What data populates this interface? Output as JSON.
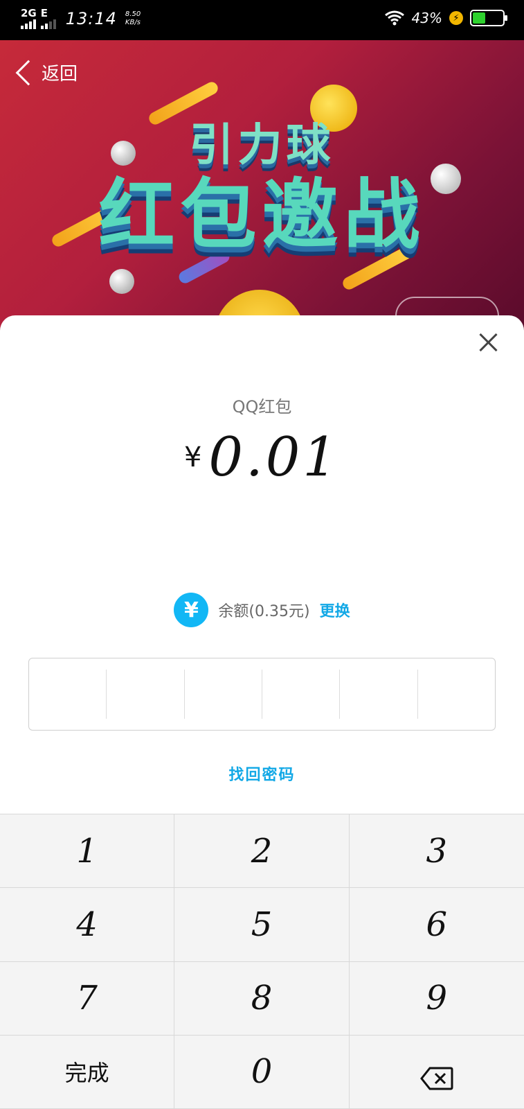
{
  "status_bar": {
    "network_1": "2G",
    "network_2": "E",
    "time": "13:14",
    "speed_value": "8.50",
    "speed_unit": "KB/s",
    "battery_percent": "43%",
    "battery_level": 0.43,
    "icons": [
      "signal-icon",
      "wifi-icon",
      "charging-icon",
      "battery-icon"
    ]
  },
  "banner": {
    "back_label": "返回",
    "title_line1": "引力球",
    "title_line2": "红包邀战"
  },
  "payment": {
    "title": "QQ红包",
    "currency_symbol": "¥",
    "amount": "0.01",
    "method_icon": "yen-icon",
    "balance_label": "余额(0.35元)",
    "change_label": "更换",
    "forgot_password_label": "找回密码"
  },
  "keypad": {
    "keys": [
      "1",
      "2",
      "3",
      "4",
      "5",
      "6",
      "7",
      "8",
      "9"
    ],
    "done_label": "完成",
    "zero_label": "0",
    "delete_icon": "backspace-icon"
  },
  "colors": {
    "accent": "#12a8e6",
    "method_icon_bg": "#12b7f5",
    "battery_fill": "#2ed12e"
  }
}
